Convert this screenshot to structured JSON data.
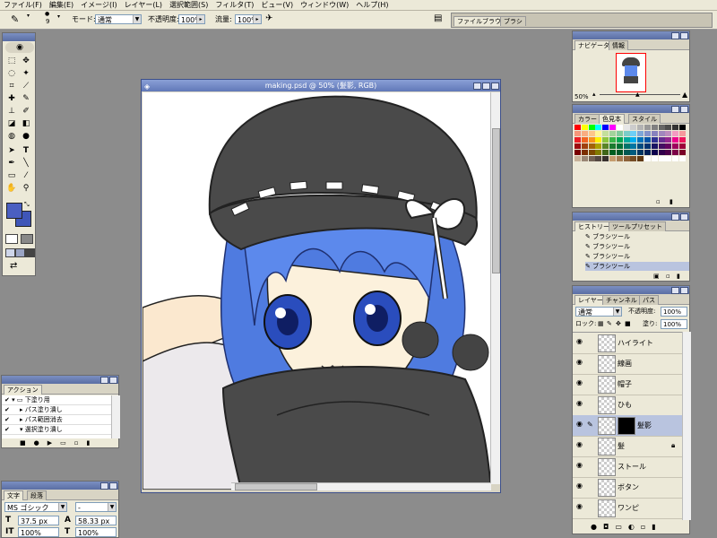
{
  "menu": [
    "ファイル(F)",
    "編集(E)",
    "イメージ(I)",
    "レイヤー(L)",
    "選択範囲(S)",
    "フィルタ(T)",
    "ビュー(V)",
    "ウィンドウ(W)",
    "ヘルプ(H)"
  ],
  "options": {
    "brush_size": "9",
    "mode_label": "モード:",
    "mode_value": "通常",
    "opacity_label": "不透明度:",
    "opacity_value": "100%",
    "flow_label": "流量:",
    "flow_value": "100%",
    "well_tabs": [
      "ファイルブラウザ",
      "ブラシ"
    ]
  },
  "document": {
    "title": "making.psd @ 50% (髪影, RGB)"
  },
  "navigator": {
    "tabs": [
      "ナビゲータ",
      "情報"
    ],
    "zoom": "50%"
  },
  "swatches": {
    "tabs": [
      "カラー",
      "色見本",
      "スタイル"
    ],
    "colors": [
      "#ff0000",
      "#ffff00",
      "#00ff00",
      "#00ffff",
      "#0000ff",
      "#ff00ff",
      "#ffffff",
      "#e6e6e6",
      "#cccccc",
      "#b3b3b3",
      "#999999",
      "#808080",
      "#666666",
      "#4d4d4d",
      "#333333",
      "#000000",
      "#f7977a",
      "#f9ad81",
      "#fdc68a",
      "#fff79a",
      "#c4df9b",
      "#a2d39c",
      "#82ca9d",
      "#7bcdc8",
      "#6ecff6",
      "#7ea7d8",
      "#8493ca",
      "#8882be",
      "#a187be",
      "#bc8dbf",
      "#f49ac2",
      "#f6989d",
      "#ed1c24",
      "#f26522",
      "#f7941d",
      "#fff200",
      "#8dc63f",
      "#39b54a",
      "#00a651",
      "#00a99d",
      "#00aeef",
      "#0072bc",
      "#0054a6",
      "#2e3192",
      "#662d91",
      "#92278f",
      "#ec008c",
      "#ed145b",
      "#9e0b0f",
      "#a0410d",
      "#a36209",
      "#aba000",
      "#598527",
      "#1a7b30",
      "#007236",
      "#00746b",
      "#0076a3",
      "#004b80",
      "#003471",
      "#1b1464",
      "#440e62",
      "#630460",
      "#9e005d",
      "#9e0039",
      "#790000",
      "#7b2e00",
      "#7d4900",
      "#827b00",
      "#406618",
      "#005e20",
      "#005826",
      "#005952",
      "#005b7f",
      "#003663",
      "#002157",
      "#0d004c",
      "#32004b",
      "#4b0049",
      "#7b0046",
      "#7a0026",
      "#c7b299",
      "#998675",
      "#736357",
      "#534741",
      "#37302d",
      "#c69c6d",
      "#a67c52",
      "#8c6239",
      "#754c24",
      "#603913",
      "#ffffff",
      "#ffffff",
      "#ffffff",
      "#ffffff",
      "#ffffff",
      "#ffffff"
    ]
  },
  "history": {
    "tabs": [
      "ヒストリー",
      "ツールプリセット"
    ],
    "items": [
      "ブラシツール",
      "ブラシツール",
      "ブラシツール",
      "ブラシツール"
    ]
  },
  "layers": {
    "tabs": [
      "レイヤー",
      "チャンネル",
      "パス"
    ],
    "mode": "通常",
    "opacity_label": "不透明度:",
    "opacity_value": "100%",
    "lock_label": "ロック:",
    "fill_label": "塗り:",
    "fill_value": "100%",
    "items": [
      "ハイライト",
      "線画",
      "帽子",
      "ひも",
      "髪影",
      "髪",
      "ストール",
      "ボタン",
      "ワンピ"
    ]
  },
  "actions": {
    "tab": "アクション",
    "items": [
      "下塗り用",
      "パス塗り潰し",
      "パス範囲消去",
      "選択塗り潰し"
    ]
  },
  "character": {
    "tabs": [
      "文字",
      "段落"
    ],
    "font": "MS ゴシック",
    "style": "-",
    "size": "37.5 px",
    "leading": "58.33 px",
    "vscale": "100%",
    "hscale": "100%"
  },
  "colors": {
    "foreground": "#4a5fc1",
    "background": "#3f56b8",
    "panel": "#ece9d8",
    "title": "#5a6ea4"
  }
}
